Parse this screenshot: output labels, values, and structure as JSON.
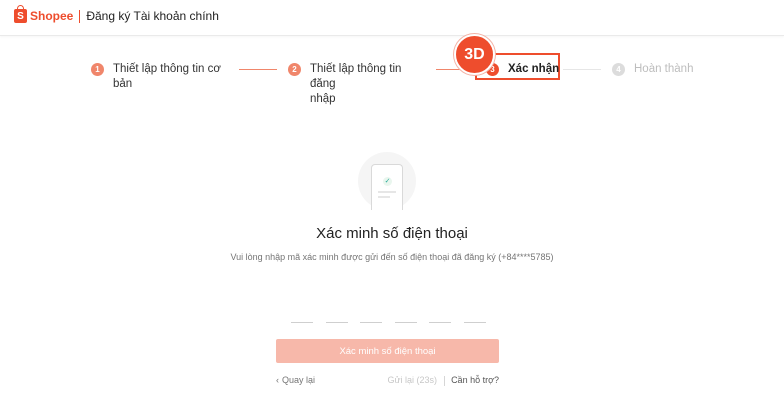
{
  "header": {
    "logo_glyph": "S",
    "brand": "Shopee",
    "title": "Đăng ký Tài khoản chính"
  },
  "steps": [
    {
      "number": "1",
      "label": "Thiết lập thông tin cơ",
      "label2": "bản",
      "state": "done"
    },
    {
      "number": "2",
      "label": "Thiết lập thông tin đăng",
      "label2": "nhập",
      "state": "done"
    },
    {
      "number": "3",
      "label": "Xác nhận",
      "state": "active"
    },
    {
      "number": "4",
      "label": "Hoàn thành",
      "state": "todo"
    }
  ],
  "badge": "3D",
  "verify": {
    "title": "Xác minh số điện thoại",
    "subtitle": "Vui lòng nhập mã xác minh được gửi đến số điện thoại đã đăng ký (+84****5785)",
    "button_label": "Xác minh số điện thoại",
    "otp_length": 6
  },
  "footer": {
    "back_label": "Quay lại",
    "resend_label": "Gửi lại (23s)",
    "help_label": "Cần hỗ trợ?"
  },
  "colors": {
    "accent": "#ee4d2d",
    "accent_light": "#f0866b",
    "button_disabled": "#f7b8aa"
  }
}
